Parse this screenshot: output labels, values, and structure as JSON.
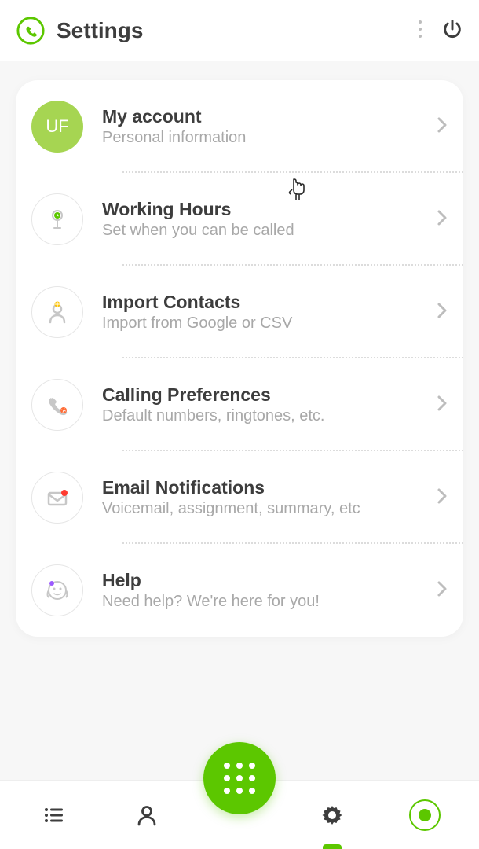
{
  "header": {
    "title": "Settings"
  },
  "account": {
    "initials": "UF"
  },
  "items": [
    {
      "title": "My account",
      "subtitle": "Personal information"
    },
    {
      "title": "Working Hours",
      "subtitle": "Set when you can be called"
    },
    {
      "title": "Import Contacts",
      "subtitle": "Import from Google or CSV"
    },
    {
      "title": "Calling Preferences",
      "subtitle": "Default numbers, ringtones, etc."
    },
    {
      "title": "Email Notifications",
      "subtitle": "Voicemail, assignment, summary, etc"
    },
    {
      "title": "Help",
      "subtitle": "Need help? We're here for you!"
    }
  ],
  "colors": {
    "brand": "#5cc700",
    "avatar": "#a6d552"
  }
}
